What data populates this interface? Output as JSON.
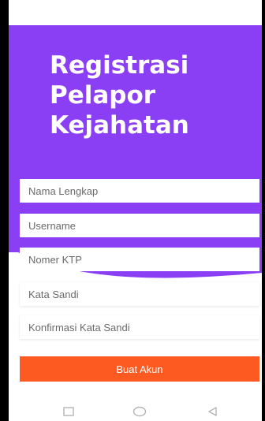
{
  "header": {
    "title_lines": [
      "Registrasi",
      "Pelapor",
      "Kejahatan"
    ]
  },
  "form": {
    "nama_lengkap_placeholder": "Nama Lengkap",
    "username_placeholder": "Username",
    "nomer_ktp_placeholder": "Nomer KTP",
    "kata_sandi_placeholder": "Kata Sandi",
    "konfirmasi_placeholder": "Konfirmasi Kata Sandi",
    "submit_label": "Buat Akun"
  },
  "navbar": {
    "icons": [
      "recent-apps-icon",
      "home-icon",
      "back-icon"
    ]
  },
  "colors": {
    "hero": "#8a3ff5",
    "button": "#fd5a22",
    "background": "#ffffff"
  }
}
